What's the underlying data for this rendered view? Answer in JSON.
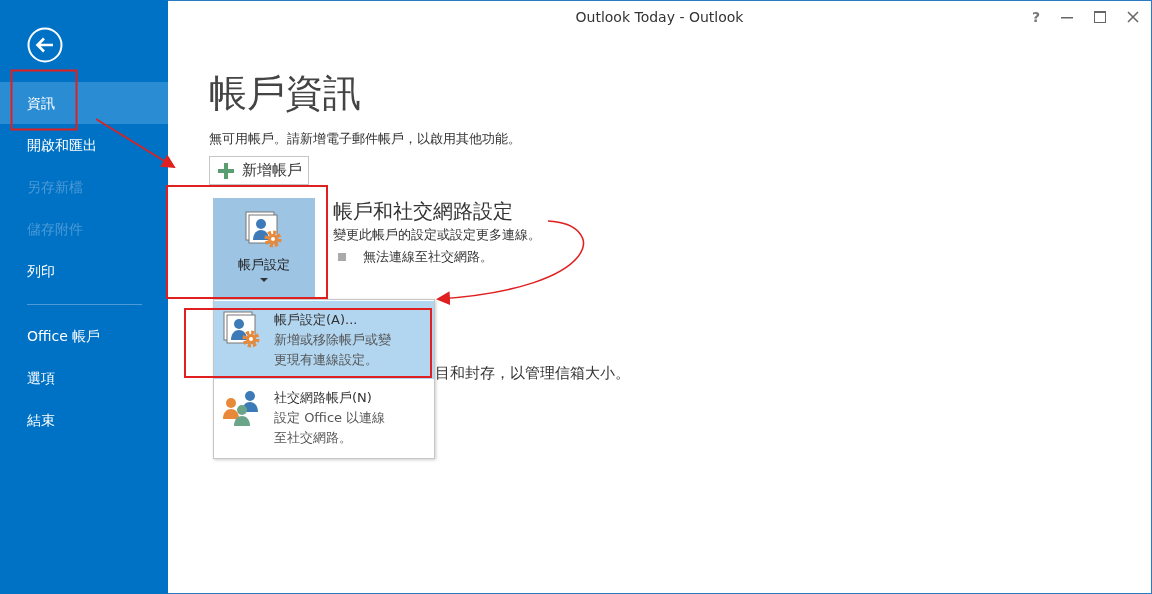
{
  "window": {
    "title": "Outlook Today - Outlook",
    "help": "?"
  },
  "sidebar": {
    "groups": [
      {
        "items": [
          {
            "label": "資訊",
            "selected": true,
            "disabled": false
          },
          {
            "label": "開啟和匯出",
            "selected": false,
            "disabled": false
          },
          {
            "label": "另存新檔",
            "selected": false,
            "disabled": true
          },
          {
            "label": "儲存附件",
            "selected": false,
            "disabled": true
          },
          {
            "label": "列印",
            "selected": false,
            "disabled": false
          }
        ]
      },
      {
        "items": [
          {
            "label": "Office 帳戶",
            "selected": false,
            "disabled": false
          },
          {
            "label": "選項",
            "selected": false,
            "disabled": false
          },
          {
            "label": "結束",
            "selected": false,
            "disabled": false
          }
        ]
      }
    ]
  },
  "main": {
    "heading": "帳戶資訊",
    "notice": "無可用帳戶。請新增電子郵件帳戶，以啟用其他功能。",
    "add_button": "新增帳戶",
    "section": {
      "button_label": "帳戶設定",
      "expanded": true,
      "heading": "帳戶和社交網路設定",
      "description": "變更此帳戶的設定或設定更多連線。",
      "bullets": [
        "無法連線至社交網路。"
      ]
    },
    "partial_text": "目和封存，以管理信箱大小。",
    "menu": [
      {
        "kind": "account",
        "title": "帳戶設定(A)...",
        "description_lines": [
          "新增或移除帳戶或變",
          "更現有連線設定。"
        ],
        "selected": true
      },
      {
        "kind": "social",
        "title": "社交網路帳戶(N)",
        "description_lines": [
          "設定 Office 以連線",
          "至社交網路。"
        ],
        "selected": false
      }
    ]
  }
}
